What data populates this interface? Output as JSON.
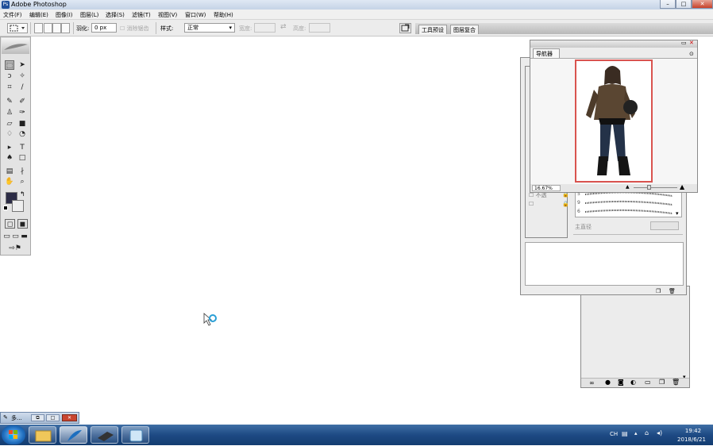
{
  "window": {
    "title": "Adobe Photoshop",
    "icon": "photoshop-icon"
  },
  "menu": [
    "文件(F)",
    "编辑(E)",
    "图像(I)",
    "图层(L)",
    "选择(S)",
    "滤镜(T)",
    "视图(V)",
    "窗口(W)",
    "帮助(H)"
  ],
  "options": {
    "feather_label": "羽化:",
    "feather_value": "0 px",
    "antialias_label": "消除锯齿",
    "style_label": "样式:",
    "style_value": "正常",
    "width_label": "宽度:",
    "height_label": "高度:",
    "swap_symbol": "⇄"
  },
  "palette_well": {
    "tabs": [
      "工具预设",
      "图层复合"
    ]
  },
  "navigator": {
    "title": "导航器",
    "zoom": "16.67%"
  },
  "layers_panel": {
    "lock_transparent": "不透",
    "lock_texture": "保护纹理",
    "main_diameter": "主直径"
  },
  "brush_sizes": [
    "5",
    "9",
    "6"
  ],
  "minimized_doc": {
    "label": "多..."
  },
  "taskbar": {
    "lang": "CH",
    "time": "19:42",
    "date": "2018/6/21"
  }
}
